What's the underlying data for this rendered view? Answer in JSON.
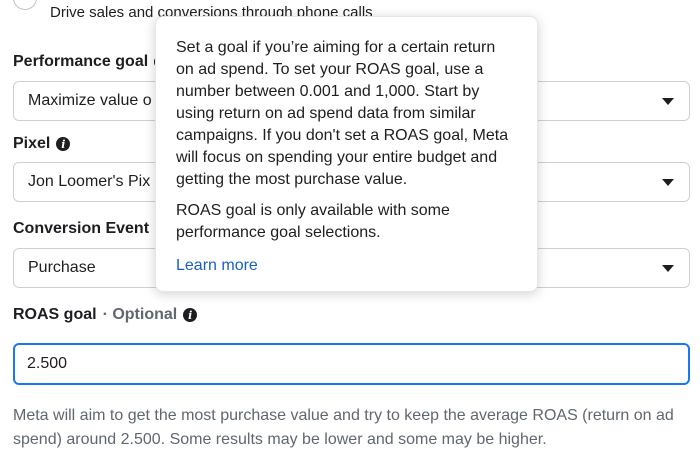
{
  "radio_option": {
    "description": "Drive sales and conversions through phone calls"
  },
  "performance_goal": {
    "label": "Performance goal",
    "value": "Maximize value o"
  },
  "pixel": {
    "label": "Pixel",
    "value": "Jon Loomer's Pix"
  },
  "conversion_event": {
    "label": "Conversion Event",
    "value": "Purchase"
  },
  "roas_goal": {
    "label": "ROAS goal",
    "optional": "· Optional",
    "value": "2.500",
    "help_text": "Meta will aim to get the most purchase value and try to keep the average ROAS (return on ad spend) around 2.500. Some results may be lower and some may be higher."
  },
  "tooltip": {
    "paragraph1": "Set a goal if you’re aiming for a certain return on ad spend. To set your ROAS goal, use a number between 0.001 and 1,000. Start by using return on ad spend data from similar campaigns. If you don't set a ROAS goal, Meta will focus on spending your entire budget and getting the most purchase value.",
    "paragraph2": "ROAS goal is only available with some performance goal selections.",
    "link": "Learn more"
  },
  "colors": {
    "accent": "#1877f2",
    "link": "#1a5ec4",
    "text": "#1c1e21",
    "muted": "#606770"
  }
}
